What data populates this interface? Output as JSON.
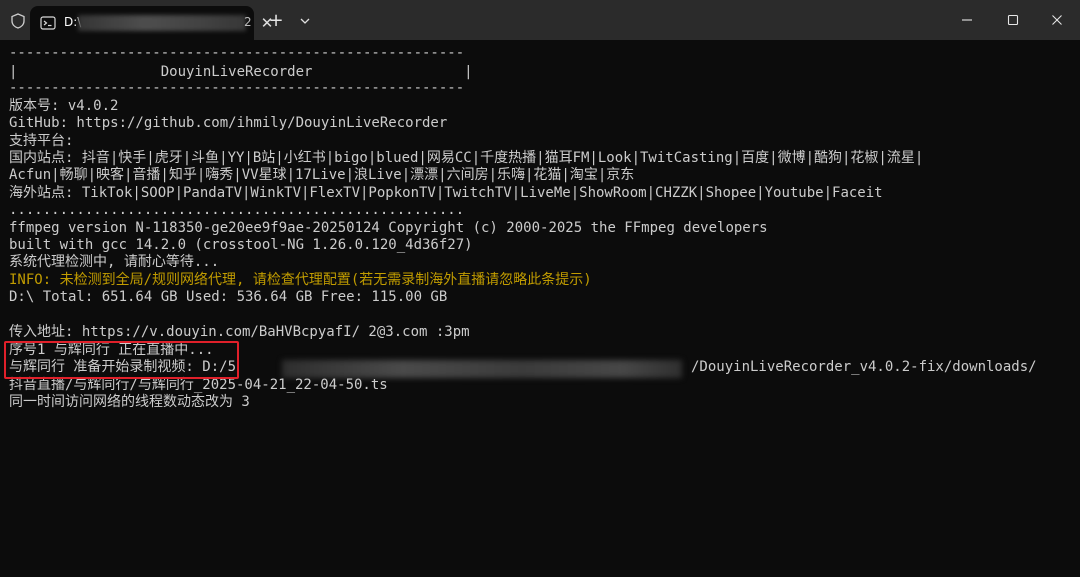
{
  "titlebar": {
    "tab_title": "D:\\",
    "tab_title_tail": "2",
    "tab_close": "✕",
    "new_tab": "+",
    "icons": [
      "shield-icon",
      "terminal-icon",
      "chevron-down-icon",
      "minimize-icon",
      "maximize-icon",
      "close-icon"
    ]
  },
  "terminal": {
    "lines": [
      "------------------------------------------------------",
      "|                 DouyinLiveRecorder                  |",
      "------------------------------------------------------",
      "版本号: v4.0.2",
      "GitHub: https://github.com/ihmily/DouyinLiveRecorder",
      "支持平台:",
      "国内站点: 抖音|快手|虎牙|斗鱼|YY|B站|小红书|bigo|blued|网易CC|千度热播|猫耳FM|Look|TwitCasting|百度|微博|酷狗|花椒|流星|",
      "Acfun|畅聊|映客|音播|知乎|嗨秀|VV星球|17Live|浪Live|漂漂|六间房|乐嗨|花猫|淘宝|京东",
      "海外站点: TikTok|SOOP|PandaTV|WinkTV|FlexTV|PopkonTV|TwitchTV|LiveMe|ShowRoom|CHZZK|Shopee|Youtube|Faceit",
      "......................................................",
      "ffmpeg version N-118350-ge20ee9f9ae-20250124 Copyright (c) 2000-2025 the FFmpeg developers",
      "built with gcc 14.2.0 (crosstool-NG 1.26.0.120_4d36f27)",
      "系统代理检测中, 请耐心等待...",
      "INFO: 未检测到全局/规则网络代理, 请检查代理配置(若无需录制海外直播请忽略此条提示)",
      "D:\\ Total: 651.64 GB Used: 536.64 GB Free: 115.00 GB",
      "",
      "传入地址: https://v.douyin.com/BaHVBcpyafI/ 2@3.com :3pm",
      "序号1 与辉同行 正在直播中...",
      "与辉同行 准备开始录制视频: D:/5",
      "抖音直播/与辉同行/与辉同行_2025-04-21_22-04-50.ts",
      "同一时间访问网络的线程数动态改为 3"
    ],
    "path_tail": "/DouyinLiveRecorder_v4.0.2-fix/downloads/"
  },
  "colors": {
    "background": "#0c0c0c",
    "text": "#cccccc",
    "info": "#c19c00",
    "highlight_box": "#e0202a",
    "titlebar": "#2b2b2b"
  }
}
